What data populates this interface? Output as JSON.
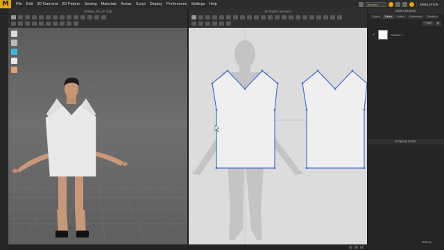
{
  "app": {
    "logo": "M"
  },
  "menu": [
    "File",
    "Edit",
    "3D Garment",
    "2D Pattern",
    "Sewing",
    "Materials",
    "Avatar",
    "Script",
    "Display",
    "Preferences",
    "Settings",
    "Help"
  ],
  "user": {
    "name": "daugsch"
  },
  "simulation_button": "SIMULATION",
  "view3d": {
    "title": "Untitled_PD_0*.zfab"
  },
  "view2d": {
    "title": "2D Pattern Window"
  },
  "object_browser": {
    "title": "Object Browser",
    "tabs": [
      "Scene",
      "Fabric",
      "Button",
      "Buttonhole",
      "Topstitch"
    ],
    "active_tab": "Fabric",
    "add_label": "+ Add",
    "fabric_name": "FABRIC 1"
  },
  "property_editor": {
    "title": "Property Editor"
  },
  "watermark": "Udemy",
  "colors": {
    "accent": "#e8a400",
    "pattern_outline": "#3d6fd6",
    "pattern_fill": "#efefef",
    "garment": "#e9e9e9"
  }
}
